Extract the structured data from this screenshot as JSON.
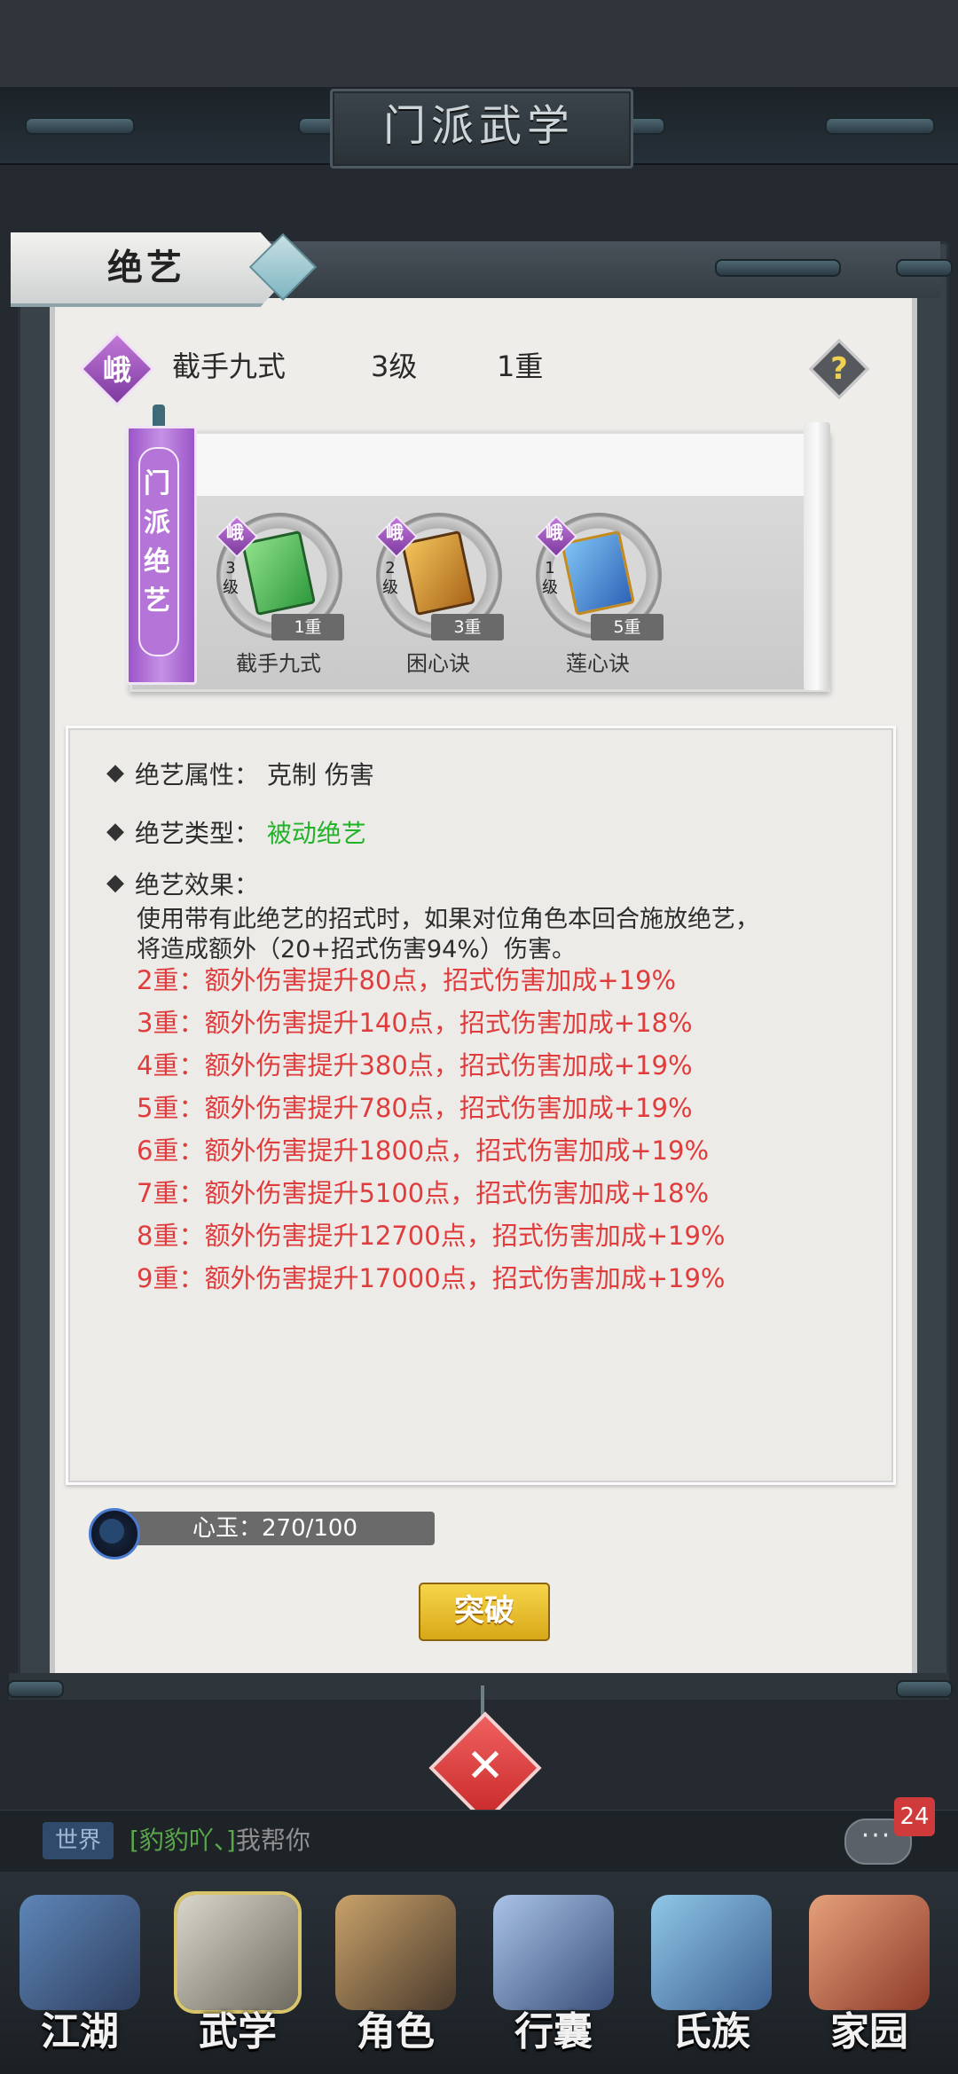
{
  "header": {
    "page_title": "门派武学"
  },
  "panel": {
    "tab_label": "绝艺"
  },
  "skill": {
    "badge_glyph": "峨",
    "name": "截手九式",
    "level": "3级",
    "tier": "1重"
  },
  "help": {
    "glyph": "?"
  },
  "sect_skills": {
    "banner_label": "门派绝艺",
    "items": [
      {
        "badge_glyph": "峨",
        "level_digit": "3",
        "level_unit": "级",
        "tier": "1重",
        "name": "截手九式"
      },
      {
        "badge_glyph": "峨",
        "level_digit": "2",
        "level_unit": "级",
        "tier": "3重",
        "name": "困心诀"
      },
      {
        "badge_glyph": "峨",
        "level_digit": "1",
        "level_unit": "级",
        "tier": "5重",
        "name": "莲心诀"
      }
    ]
  },
  "details": {
    "bullet": "◆",
    "attribute_label": "绝艺属性：",
    "attribute_value": "克制 伤害",
    "type_label": "绝艺类型：",
    "type_value": "被动绝艺",
    "effect_label": "绝艺效果：",
    "effect_lines": [
      "使用带有此绝艺的招式时，如果对位角色本回合施放绝艺，",
      "将造成额外（20+招式伤害94%）伤害。"
    ],
    "tier_lines": [
      "2重：额外伤害提升80点，招式伤害加成+19%",
      "3重：额外伤害提升140点，招式伤害加成+18%",
      "4重：额外伤害提升380点，招式伤害加成+19%",
      "5重：额外伤害提升780点，招式伤害加成+19%",
      "6重：额外伤害提升1800点，招式伤害加成+19%",
      "7重：额外伤害提升5100点，招式伤害加成+18%",
      "8重：额外伤害提升12700点，招式伤害加成+19%",
      "9重：额外伤害提升17000点，招式伤害加成+19%"
    ]
  },
  "resource": {
    "label": "心玉：270/100"
  },
  "actions": {
    "breakthrough_label": "突破",
    "close_glyph": "✕"
  },
  "chat": {
    "channel": "世界",
    "sender": "[豹豹吖、]",
    "message": "我帮你",
    "dots": "···",
    "unread_count": "24"
  },
  "nav": {
    "items": [
      {
        "label": "江湖"
      },
      {
        "label": "武学"
      },
      {
        "label": "角色"
      },
      {
        "label": "行囊"
      },
      {
        "label": "氏族"
      },
      {
        "label": "家园"
      }
    ]
  },
  "colors": {
    "tier_text": "#e03c3c",
    "passive_type": "#22b329",
    "sect_badge": "#9b55c7",
    "breakthrough_button": "#f0c534",
    "close_button": "#e04848"
  }
}
